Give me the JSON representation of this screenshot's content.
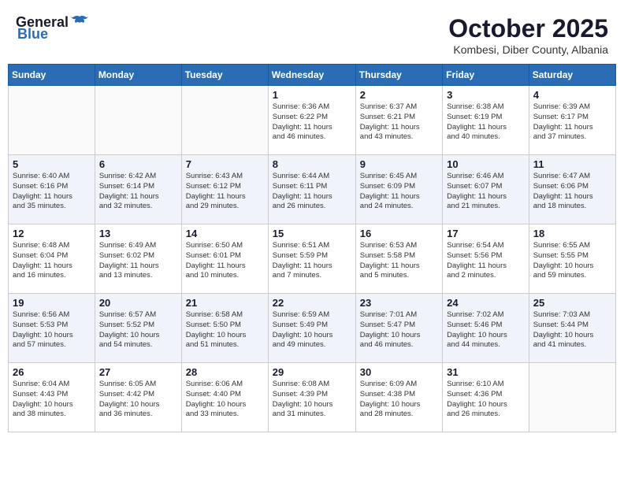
{
  "header": {
    "logo_general": "General",
    "logo_blue": "Blue",
    "month": "October 2025",
    "location": "Kombesi, Diber County, Albania"
  },
  "weekdays": [
    "Sunday",
    "Monday",
    "Tuesday",
    "Wednesday",
    "Thursday",
    "Friday",
    "Saturday"
  ],
  "weeks": [
    [
      {
        "day": "",
        "info": ""
      },
      {
        "day": "",
        "info": ""
      },
      {
        "day": "",
        "info": ""
      },
      {
        "day": "1",
        "info": "Sunrise: 6:36 AM\nSunset: 6:22 PM\nDaylight: 11 hours\nand 46 minutes."
      },
      {
        "day": "2",
        "info": "Sunrise: 6:37 AM\nSunset: 6:21 PM\nDaylight: 11 hours\nand 43 minutes."
      },
      {
        "day": "3",
        "info": "Sunrise: 6:38 AM\nSunset: 6:19 PM\nDaylight: 11 hours\nand 40 minutes."
      },
      {
        "day": "4",
        "info": "Sunrise: 6:39 AM\nSunset: 6:17 PM\nDaylight: 11 hours\nand 37 minutes."
      }
    ],
    [
      {
        "day": "5",
        "info": "Sunrise: 6:40 AM\nSunset: 6:16 PM\nDaylight: 11 hours\nand 35 minutes."
      },
      {
        "day": "6",
        "info": "Sunrise: 6:42 AM\nSunset: 6:14 PM\nDaylight: 11 hours\nand 32 minutes."
      },
      {
        "day": "7",
        "info": "Sunrise: 6:43 AM\nSunset: 6:12 PM\nDaylight: 11 hours\nand 29 minutes."
      },
      {
        "day": "8",
        "info": "Sunrise: 6:44 AM\nSunset: 6:11 PM\nDaylight: 11 hours\nand 26 minutes."
      },
      {
        "day": "9",
        "info": "Sunrise: 6:45 AM\nSunset: 6:09 PM\nDaylight: 11 hours\nand 24 minutes."
      },
      {
        "day": "10",
        "info": "Sunrise: 6:46 AM\nSunset: 6:07 PM\nDaylight: 11 hours\nand 21 minutes."
      },
      {
        "day": "11",
        "info": "Sunrise: 6:47 AM\nSunset: 6:06 PM\nDaylight: 11 hours\nand 18 minutes."
      }
    ],
    [
      {
        "day": "12",
        "info": "Sunrise: 6:48 AM\nSunset: 6:04 PM\nDaylight: 11 hours\nand 16 minutes."
      },
      {
        "day": "13",
        "info": "Sunrise: 6:49 AM\nSunset: 6:02 PM\nDaylight: 11 hours\nand 13 minutes."
      },
      {
        "day": "14",
        "info": "Sunrise: 6:50 AM\nSunset: 6:01 PM\nDaylight: 11 hours\nand 10 minutes."
      },
      {
        "day": "15",
        "info": "Sunrise: 6:51 AM\nSunset: 5:59 PM\nDaylight: 11 hours\nand 7 minutes."
      },
      {
        "day": "16",
        "info": "Sunrise: 6:53 AM\nSunset: 5:58 PM\nDaylight: 11 hours\nand 5 minutes."
      },
      {
        "day": "17",
        "info": "Sunrise: 6:54 AM\nSunset: 5:56 PM\nDaylight: 11 hours\nand 2 minutes."
      },
      {
        "day": "18",
        "info": "Sunrise: 6:55 AM\nSunset: 5:55 PM\nDaylight: 10 hours\nand 59 minutes."
      }
    ],
    [
      {
        "day": "19",
        "info": "Sunrise: 6:56 AM\nSunset: 5:53 PM\nDaylight: 10 hours\nand 57 minutes."
      },
      {
        "day": "20",
        "info": "Sunrise: 6:57 AM\nSunset: 5:52 PM\nDaylight: 10 hours\nand 54 minutes."
      },
      {
        "day": "21",
        "info": "Sunrise: 6:58 AM\nSunset: 5:50 PM\nDaylight: 10 hours\nand 51 minutes."
      },
      {
        "day": "22",
        "info": "Sunrise: 6:59 AM\nSunset: 5:49 PM\nDaylight: 10 hours\nand 49 minutes."
      },
      {
        "day": "23",
        "info": "Sunrise: 7:01 AM\nSunset: 5:47 PM\nDaylight: 10 hours\nand 46 minutes."
      },
      {
        "day": "24",
        "info": "Sunrise: 7:02 AM\nSunset: 5:46 PM\nDaylight: 10 hours\nand 44 minutes."
      },
      {
        "day": "25",
        "info": "Sunrise: 7:03 AM\nSunset: 5:44 PM\nDaylight: 10 hours\nand 41 minutes."
      }
    ],
    [
      {
        "day": "26",
        "info": "Sunrise: 6:04 AM\nSunset: 4:43 PM\nDaylight: 10 hours\nand 38 minutes."
      },
      {
        "day": "27",
        "info": "Sunrise: 6:05 AM\nSunset: 4:42 PM\nDaylight: 10 hours\nand 36 minutes."
      },
      {
        "day": "28",
        "info": "Sunrise: 6:06 AM\nSunset: 4:40 PM\nDaylight: 10 hours\nand 33 minutes."
      },
      {
        "day": "29",
        "info": "Sunrise: 6:08 AM\nSunset: 4:39 PM\nDaylight: 10 hours\nand 31 minutes."
      },
      {
        "day": "30",
        "info": "Sunrise: 6:09 AM\nSunset: 4:38 PM\nDaylight: 10 hours\nand 28 minutes."
      },
      {
        "day": "31",
        "info": "Sunrise: 6:10 AM\nSunset: 4:36 PM\nDaylight: 10 hours\nand 26 minutes."
      },
      {
        "day": "",
        "info": ""
      }
    ]
  ]
}
